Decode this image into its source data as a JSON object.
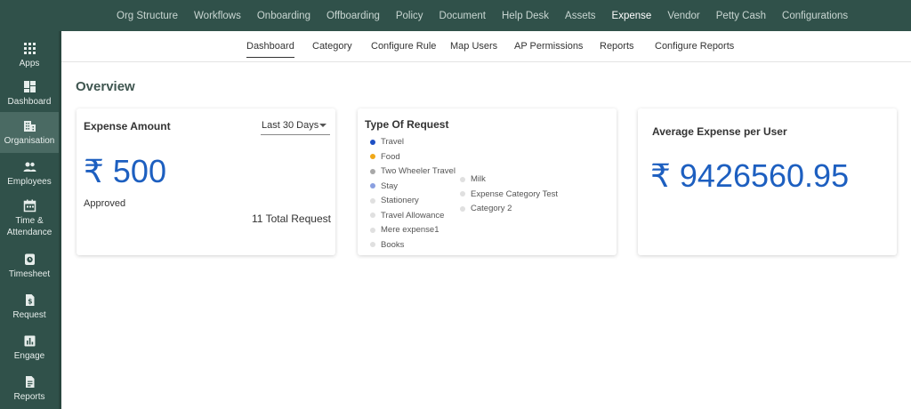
{
  "topnav": {
    "items": [
      "Org Structure",
      "Workflows",
      "Onboarding",
      "Offboarding",
      "Policy",
      "Document",
      "Help Desk",
      "Assets",
      "Expense",
      "Vendor",
      "Petty Cash",
      "Configurations"
    ],
    "active_index": 8
  },
  "sidebar": {
    "items": [
      {
        "label": "Apps",
        "icon": "apps-grid-icon"
      },
      {
        "label": "Dashboard",
        "icon": "dashboard-icon"
      },
      {
        "label": "Organisation",
        "icon": "organisation-icon"
      },
      {
        "label": "Employees",
        "icon": "employees-icon"
      },
      {
        "label": "Time &",
        "label2": "Attendance",
        "icon": "calendar-icon"
      },
      {
        "label": "Timesheet",
        "icon": "timesheet-icon"
      },
      {
        "label": "Request",
        "icon": "request-icon"
      },
      {
        "label": "Engage",
        "icon": "engage-chart-icon"
      },
      {
        "label": "Reports",
        "icon": "reports-icon"
      }
    ],
    "active_index": 2
  },
  "subnav": {
    "items": [
      "Dashboard",
      "Category",
      "Configure Rule",
      "Map Users",
      "AP Permissions",
      "Reports",
      "Configure Reports"
    ],
    "active_index": 0
  },
  "page": {
    "title": "Overview"
  },
  "expense_card": {
    "title": "Expense Amount",
    "period": "Last 30 Days",
    "amount": "₹ 500",
    "status": "Approved",
    "total_request": "11 Total Request"
  },
  "request_card": {
    "title": "Type Of Request",
    "legend_col1": [
      {
        "label": "Travel",
        "color": "#1d4fc4"
      },
      {
        "label": "Food",
        "color": "#f0a818"
      },
      {
        "label": "Two Wheeler Travel",
        "color": "#a8a8a8"
      },
      {
        "label": "Stay",
        "color": "#8a9fe0"
      },
      {
        "label": "Stationery",
        "color": "#e0e0e0"
      },
      {
        "label": "Travel Allowance",
        "color": "#e0e0e0"
      },
      {
        "label": "Mere expense1",
        "color": "#e0e0e0"
      },
      {
        "label": "Books",
        "color": "#e0e0e0"
      }
    ],
    "legend_col2": [
      {
        "label": "Milk",
        "color": "#e0e0e0"
      },
      {
        "label": "Expense Category Test",
        "color": "#e0e0e0"
      },
      {
        "label": "Category 2",
        "color": "#e0e0e0"
      }
    ]
  },
  "average_card": {
    "title": "Average Expense per User",
    "amount": "₹ 9426560.95"
  },
  "colors": {
    "sidebar": "#30514a",
    "accent": "#1d5fc0"
  }
}
